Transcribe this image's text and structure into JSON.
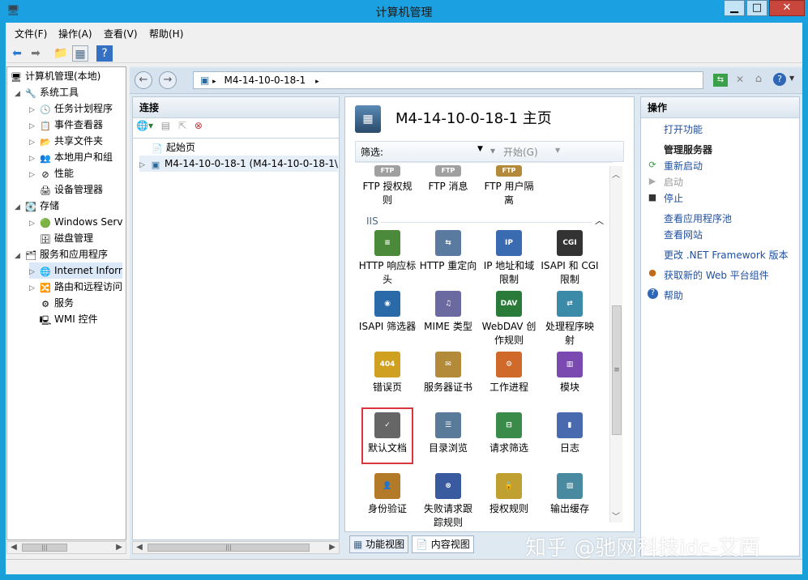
{
  "window": {
    "title": "计算机管理",
    "minimize": "▁",
    "maximize": "□",
    "close": "✕"
  },
  "menu": [
    "文件(F)",
    "操作(A)",
    "查看(V)",
    "帮助(H)"
  ],
  "tree": {
    "root": "计算机管理(本地)",
    "items": [
      "系统工具",
      "任务计划程序",
      "事件查看器",
      "共享文件夹",
      "本地用户和组",
      "性能",
      "设备管理器",
      "存储",
      "Windows Serv",
      "磁盘管理",
      "服务和应用程序",
      "Internet Inforr",
      "路由和远程访问",
      "服务",
      "WMI 控件"
    ]
  },
  "iis": {
    "address": [
      "M4-14-10-0-18-1",
      "▸"
    ],
    "connections": {
      "title": "连接",
      "start_page": "起始页",
      "server": "M4-14-10-0-18-1 (M4-14-10-0-18-1\\"
    },
    "home": {
      "title": "M4-14-10-0-18-1 主页",
      "filter_label": "筛选:",
      "start_label": "开始(G)",
      "group_label": "IIS",
      "ftp_features": [
        "FTP 授权规\n则",
        "FTP 消息",
        "FTP 用户隔\n离"
      ],
      "features": [
        "HTTP 响应标\n头",
        "HTTP 重定向",
        "IP 地址和域\n限制",
        "ISAPI 和 CGI\n限制",
        "ISAPI 筛选器",
        "MIME 类型",
        "WebDAV 创\n作规则",
        "处理程序映\n射",
        "错误页",
        "服务器证书",
        "工作进程",
        "模块",
        "默认文档",
        "目录浏览",
        "请求筛选",
        "日志",
        "身份验证",
        "失败请求跟\n踪规则",
        "授权规则",
        "输出缓存"
      ]
    },
    "tabs": {
      "feature_view": "功能视图",
      "content_view": "内容视图"
    },
    "actions": {
      "title": "操作",
      "open_feature": "打开功能",
      "manage_server": "管理服务器",
      "restart": "重新启动",
      "start": "启动",
      "stop": "停止",
      "view_app_pools": "查看应用程序池",
      "view_sites": "查看网站",
      "change_net": "更改 .NET Framework 版本",
      "get_web_platform": "获取新的 Web 平台组件",
      "help": "帮助"
    }
  },
  "watermark": "知乎 @驰网科技idc-艾西",
  "colors": {
    "titlebar": "#1ba1e2",
    "link": "#1f4f9e",
    "highlight": "#d9363e"
  }
}
